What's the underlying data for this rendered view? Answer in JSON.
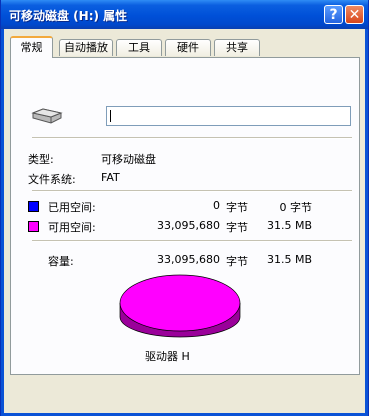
{
  "window": {
    "title": "可移动磁盘 (H:) 属性"
  },
  "titlebar_buttons": {
    "help": "?",
    "close": "✕"
  },
  "tabs": [
    {
      "label": "常规",
      "active": true
    },
    {
      "label": "自动播放",
      "active": false
    },
    {
      "label": "工具",
      "active": false
    },
    {
      "label": "硬件",
      "active": false
    },
    {
      "label": "共享",
      "active": false
    }
  ],
  "general": {
    "name_value": "",
    "type_label": "类型:",
    "type_value": "可移动磁盘",
    "fs_label": "文件系统:",
    "fs_value": "FAT",
    "used": {
      "label": "已用空间:",
      "bytes": "0",
      "unit": "字节",
      "size": "0 字节",
      "color": "#0000ff"
    },
    "free": {
      "label": "可用空间:",
      "bytes": "33,095,680",
      "unit": "字节",
      "size": "31.5 MB",
      "color": "#ff00ff"
    },
    "capacity": {
      "label": "容量:",
      "bytes": "33,095,680",
      "unit": "字节",
      "size": "31.5 MB"
    },
    "drive_label": "驱动器 H",
    "pie": {
      "used_fraction": 0,
      "free_fraction": 1
    }
  },
  "colors": {
    "titlebar": "#0050d8",
    "dialog": "#ece9d8",
    "free": "#ff00ff",
    "free_dark": "#9a009a",
    "used": "#0000ff"
  },
  "icons": {
    "drive": "removable-drive-icon",
    "help": "help-icon",
    "close": "close-icon"
  }
}
